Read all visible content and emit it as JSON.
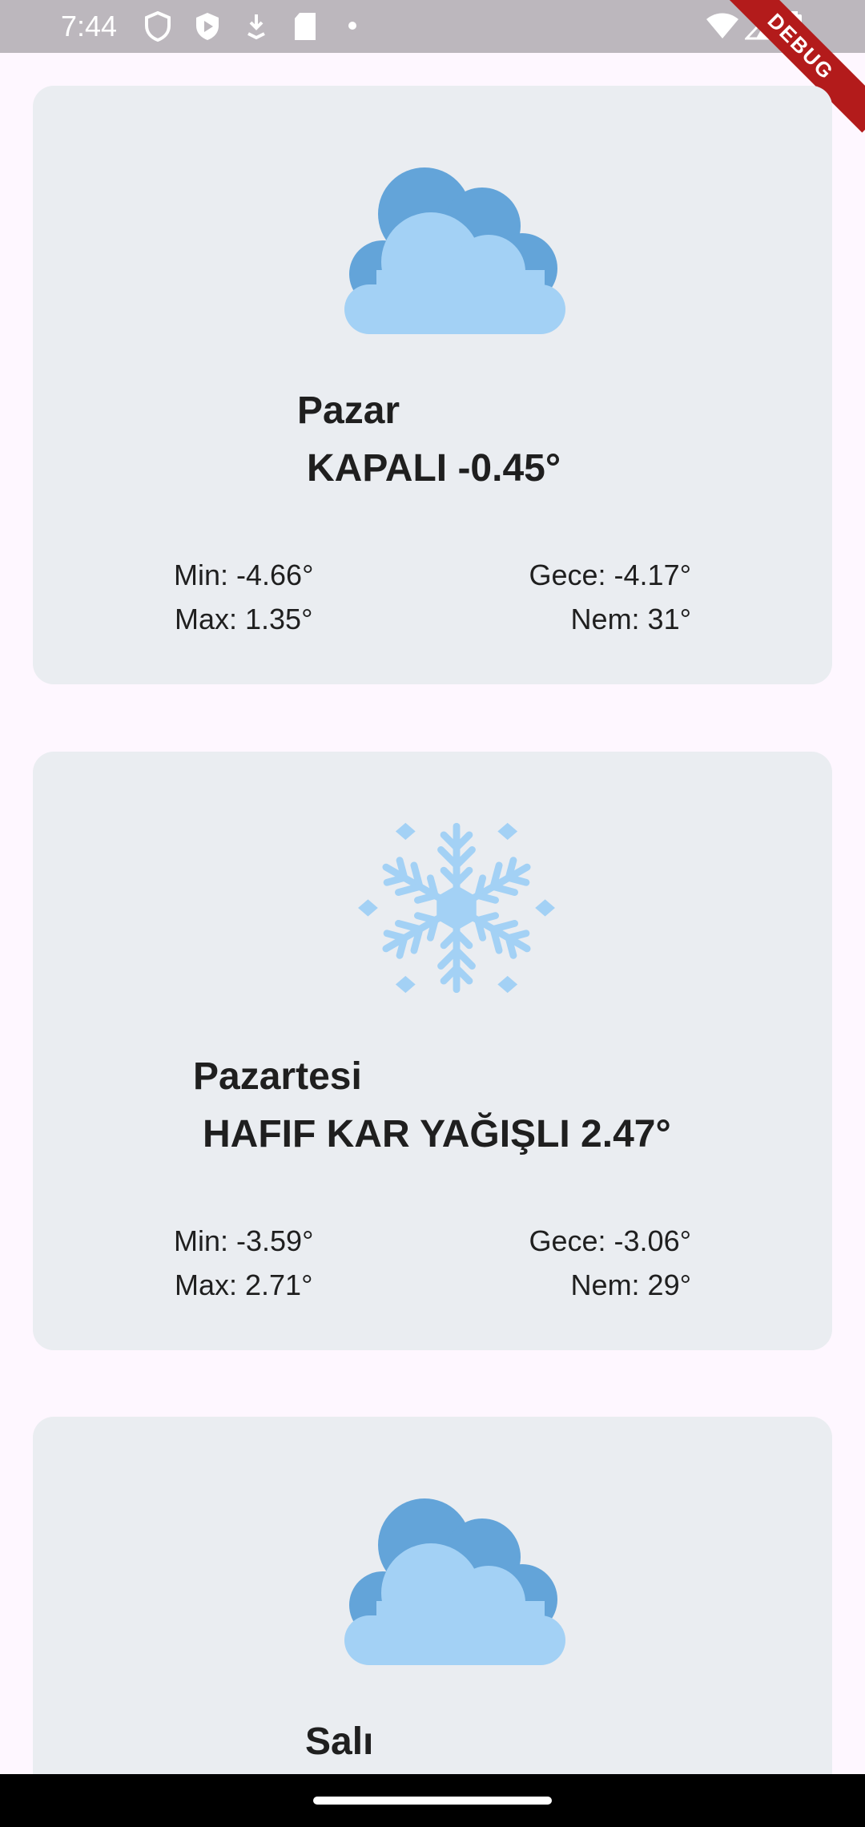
{
  "status_bar": {
    "time": "7:44",
    "debug_label": "DEBUG"
  },
  "forecast": [
    {
      "day": "Pazar",
      "summary": "KAPALI -0.45°",
      "icon": "cloud-icon",
      "min": "Min: -4.66°",
      "max": "Max: 1.35°",
      "night": "Gece: -4.17°",
      "humidity": "Nem: 31°"
    },
    {
      "day": "Pazartesi",
      "summary": "HAFIF KAR YAĞIŞLI 2.47°",
      "icon": "snowflake-icon",
      "min": "Min: -3.59°",
      "max": "Max: 2.71°",
      "night": "Gece: -3.06°",
      "humidity": "Nem: 29°"
    },
    {
      "day": "Salı",
      "icon": "cloud-icon"
    }
  ],
  "colors": {
    "background": "#fef7ff",
    "card": "#eaedf1",
    "cloud_light": "#a3d1f5",
    "cloud_dark": "#63a4d9",
    "snow": "#a3d1f5"
  }
}
